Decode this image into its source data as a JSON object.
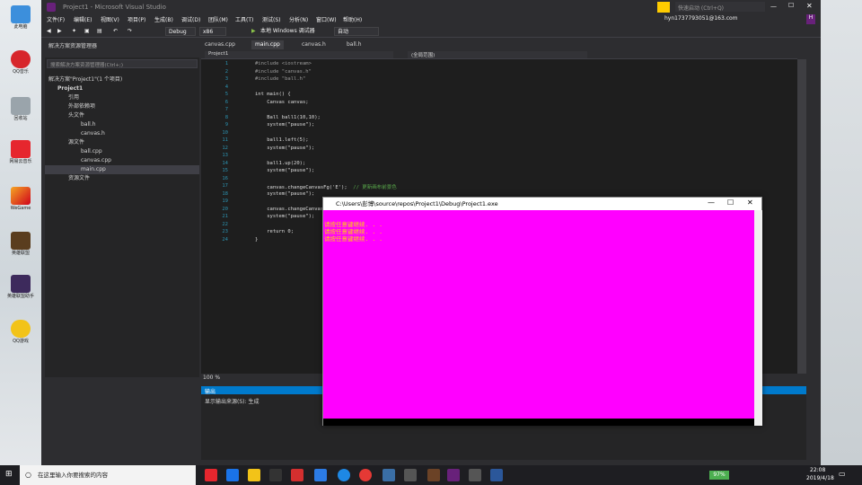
{
  "window": {
    "title": "Project1 - Microsoft Visual Studio",
    "quick_launch": "快速启动 (Ctrl+Q)",
    "account": "hyn1737793051@163.com"
  },
  "menus": [
    "文件(F)",
    "编辑(E)",
    "视图(V)",
    "项目(P)",
    "生成(B)",
    "调试(D)",
    "团队(M)",
    "工具(T)",
    "测试(S)",
    "分析(N)",
    "窗口(W)",
    "帮助(H)"
  ],
  "toolbar": {
    "config": "Debug",
    "platform": "x86",
    "run": "本地 Windows 调试器",
    "mode": "自动"
  },
  "desktop_icons": [
    "此电脑",
    "QQ音乐",
    "回收站",
    "网易云音乐",
    "WeGame",
    "英雄联盟",
    "英雄联盟助手",
    "QQ游戏"
  ],
  "solution_explorer": {
    "title": "解决方案资源管理器",
    "search_placeholder": "搜索解决方案资源管理器(Ctrl+;)",
    "items": [
      {
        "label": "解决方案\"Project1\"(1 个项目)",
        "indent": 0
      },
      {
        "label": "Project1",
        "indent": 1
      },
      {
        "label": "引用",
        "indent": 2
      },
      {
        "label": "外部依赖项",
        "indent": 2
      },
      {
        "label": "头文件",
        "indent": 2
      },
      {
        "label": "ball.h",
        "indent": 3
      },
      {
        "label": "canvas.h",
        "indent": 3
      },
      {
        "label": "源文件",
        "indent": 2
      },
      {
        "label": "ball.cpp",
        "indent": 3
      },
      {
        "label": "canvas.cpp",
        "indent": 3
      },
      {
        "label": "main.cpp",
        "indent": 3
      },
      {
        "label": "资源文件",
        "indent": 2
      }
    ]
  },
  "tabs": [
    "canvas.cpp",
    "main.cpp",
    "canvas.h",
    "ball.h"
  ],
  "active_tab": 1,
  "navbar": {
    "scope": "Project1",
    "member": "(全局范围)"
  },
  "code_lines": [
    "#include <iostream>",
    "#include \"canvas.h\"",
    "#include \"ball.h\"",
    "",
    "int main() {",
    "    Canvas canvas;",
    "",
    "    Ball ball1(10,10);",
    "    system(\"pause\");",
    "",
    "    ball1.left(5);",
    "    system(\"pause\");",
    "",
    "    ball1.up(20);",
    "    system(\"pause\");",
    "",
    "    canvas.changeCanvasFg('E');  // 更新画布前景色",
    "    system(\"pause\");",
    "",
    "    canvas.changeCanvasBg",
    "    system(\"pause\");",
    "",
    "    return 0;",
    "}"
  ],
  "zoom": "100 %",
  "output": {
    "title": "输出",
    "source_label": "显示输出来源(S):",
    "source_value": "生成"
  },
  "console": {
    "title": "C:\\Users\\彭博\\source\\repos\\Project1\\Debug\\Project1.exe",
    "lines": [
      "请按任意键继续. . .",
      "请按任意键继续. . .",
      "请按任意键继续. . ."
    ],
    "bg_color": "#ff00ff",
    "fg_color": "#ffd800"
  },
  "taskbar": {
    "search": "在这里输入你要搜索的内容",
    "battery": "97%",
    "time": "22:08",
    "date": "2019/4/18"
  }
}
